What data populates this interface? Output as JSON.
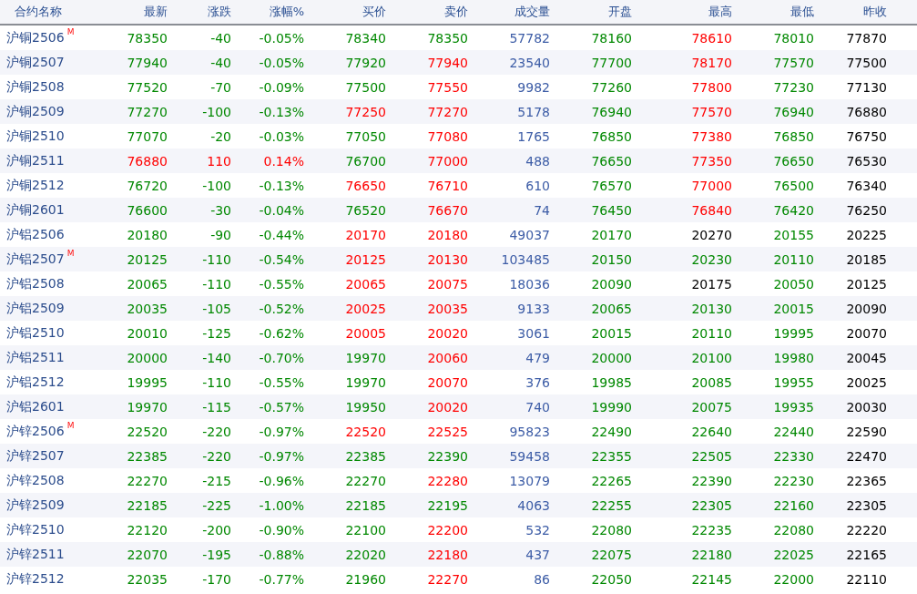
{
  "table": {
    "columns": [
      "合约名称",
      "最新",
      "涨跌",
      "涨幅%",
      "买价",
      "卖价",
      "成交量",
      "开盘",
      "最高",
      "最低",
      "昨收"
    ],
    "rows": [
      {
        "cells": [
          {
            "text": "沪铜2506",
            "badge": "M"
          },
          {
            "text": "78350",
            "color": "#008800"
          },
          {
            "text": "-40",
            "color": "#008800"
          },
          {
            "text": "-0.05%",
            "color": "#008800"
          },
          {
            "text": "78340",
            "color": "#008800"
          },
          {
            "text": "78350",
            "color": "#008800"
          },
          {
            "text": "57782",
            "color": "#3c5ca6"
          },
          {
            "text": "78160",
            "color": "#008800"
          },
          {
            "text": "78610",
            "color": "#ff0000"
          },
          {
            "text": "78010",
            "color": "#008800"
          },
          {
            "text": "77870",
            "color": "#000000"
          }
        ]
      },
      {
        "cells": [
          {
            "text": "沪铜2507"
          },
          {
            "text": "77940",
            "color": "#008800"
          },
          {
            "text": "-40",
            "color": "#008800"
          },
          {
            "text": "-0.05%",
            "color": "#008800"
          },
          {
            "text": "77920",
            "color": "#008800"
          },
          {
            "text": "77940",
            "color": "#ff0000"
          },
          {
            "text": "23540",
            "color": "#3c5ca6"
          },
          {
            "text": "77700",
            "color": "#008800"
          },
          {
            "text": "78170",
            "color": "#ff0000"
          },
          {
            "text": "77570",
            "color": "#008800"
          },
          {
            "text": "77500",
            "color": "#000000"
          }
        ]
      },
      {
        "cells": [
          {
            "text": "沪铜2508"
          },
          {
            "text": "77520",
            "color": "#008800"
          },
          {
            "text": "-70",
            "color": "#008800"
          },
          {
            "text": "-0.09%",
            "color": "#008800"
          },
          {
            "text": "77500",
            "color": "#008800"
          },
          {
            "text": "77550",
            "color": "#ff0000"
          },
          {
            "text": "9982",
            "color": "#3c5ca6"
          },
          {
            "text": "77260",
            "color": "#008800"
          },
          {
            "text": "77800",
            "color": "#ff0000"
          },
          {
            "text": "77230",
            "color": "#008800"
          },
          {
            "text": "77130",
            "color": "#000000"
          }
        ]
      },
      {
        "cells": [
          {
            "text": "沪铜2509"
          },
          {
            "text": "77270",
            "color": "#008800"
          },
          {
            "text": "-100",
            "color": "#008800"
          },
          {
            "text": "-0.13%",
            "color": "#008800"
          },
          {
            "text": "77250",
            "color": "#ff0000"
          },
          {
            "text": "77270",
            "color": "#ff0000"
          },
          {
            "text": "5178",
            "color": "#3c5ca6"
          },
          {
            "text": "76940",
            "color": "#008800"
          },
          {
            "text": "77570",
            "color": "#ff0000"
          },
          {
            "text": "76940",
            "color": "#008800"
          },
          {
            "text": "76880",
            "color": "#000000"
          }
        ]
      },
      {
        "cells": [
          {
            "text": "沪铜2510"
          },
          {
            "text": "77070",
            "color": "#008800"
          },
          {
            "text": "-20",
            "color": "#008800"
          },
          {
            "text": "-0.03%",
            "color": "#008800"
          },
          {
            "text": "77050",
            "color": "#008800"
          },
          {
            "text": "77080",
            "color": "#ff0000"
          },
          {
            "text": "1765",
            "color": "#3c5ca6"
          },
          {
            "text": "76850",
            "color": "#008800"
          },
          {
            "text": "77380",
            "color": "#ff0000"
          },
          {
            "text": "76850",
            "color": "#008800"
          },
          {
            "text": "76750",
            "color": "#000000"
          }
        ]
      },
      {
        "cells": [
          {
            "text": "沪铜2511"
          },
          {
            "text": "76880",
            "color": "#ff0000"
          },
          {
            "text": "110",
            "color": "#ff0000"
          },
          {
            "text": "0.14%",
            "color": "#ff0000"
          },
          {
            "text": "76700",
            "color": "#008800"
          },
          {
            "text": "77000",
            "color": "#ff0000"
          },
          {
            "text": "488",
            "color": "#3c5ca6"
          },
          {
            "text": "76650",
            "color": "#008800"
          },
          {
            "text": "77350",
            "color": "#ff0000"
          },
          {
            "text": "76650",
            "color": "#008800"
          },
          {
            "text": "76530",
            "color": "#000000"
          }
        ]
      },
      {
        "cells": [
          {
            "text": "沪铜2512"
          },
          {
            "text": "76720",
            "color": "#008800"
          },
          {
            "text": "-100",
            "color": "#008800"
          },
          {
            "text": "-0.13%",
            "color": "#008800"
          },
          {
            "text": "76650",
            "color": "#ff0000"
          },
          {
            "text": "76710",
            "color": "#ff0000"
          },
          {
            "text": "610",
            "color": "#3c5ca6"
          },
          {
            "text": "76570",
            "color": "#008800"
          },
          {
            "text": "77000",
            "color": "#ff0000"
          },
          {
            "text": "76500",
            "color": "#008800"
          },
          {
            "text": "76340",
            "color": "#000000"
          }
        ]
      },
      {
        "cells": [
          {
            "text": "沪铜2601"
          },
          {
            "text": "76600",
            "color": "#008800"
          },
          {
            "text": "-30",
            "color": "#008800"
          },
          {
            "text": "-0.04%",
            "color": "#008800"
          },
          {
            "text": "76520",
            "color": "#008800"
          },
          {
            "text": "76670",
            "color": "#ff0000"
          },
          {
            "text": "74",
            "color": "#3c5ca6"
          },
          {
            "text": "76450",
            "color": "#008800"
          },
          {
            "text": "76840",
            "color": "#ff0000"
          },
          {
            "text": "76420",
            "color": "#008800"
          },
          {
            "text": "76250",
            "color": "#000000"
          }
        ]
      },
      {
        "cells": [
          {
            "text": "沪铝2506"
          },
          {
            "text": "20180",
            "color": "#008800"
          },
          {
            "text": "-90",
            "color": "#008800"
          },
          {
            "text": "-0.44%",
            "color": "#008800"
          },
          {
            "text": "20170",
            "color": "#ff0000"
          },
          {
            "text": "20180",
            "color": "#ff0000"
          },
          {
            "text": "49037",
            "color": "#3c5ca6"
          },
          {
            "text": "20170",
            "color": "#008800"
          },
          {
            "text": "20270",
            "color": "#000000"
          },
          {
            "text": "20155",
            "color": "#008800"
          },
          {
            "text": "20225",
            "color": "#000000"
          }
        ]
      },
      {
        "cells": [
          {
            "text": "沪铝2507",
            "badge": "M"
          },
          {
            "text": "20125",
            "color": "#008800"
          },
          {
            "text": "-110",
            "color": "#008800"
          },
          {
            "text": "-0.54%",
            "color": "#008800"
          },
          {
            "text": "20125",
            "color": "#ff0000"
          },
          {
            "text": "20130",
            "color": "#ff0000"
          },
          {
            "text": "103485",
            "color": "#3c5ca6"
          },
          {
            "text": "20150",
            "color": "#008800"
          },
          {
            "text": "20230",
            "color": "#008800"
          },
          {
            "text": "20110",
            "color": "#008800"
          },
          {
            "text": "20185",
            "color": "#000000"
          }
        ]
      },
      {
        "cells": [
          {
            "text": "沪铝2508"
          },
          {
            "text": "20065",
            "color": "#008800"
          },
          {
            "text": "-110",
            "color": "#008800"
          },
          {
            "text": "-0.55%",
            "color": "#008800"
          },
          {
            "text": "20065",
            "color": "#ff0000"
          },
          {
            "text": "20075",
            "color": "#ff0000"
          },
          {
            "text": "18036",
            "color": "#3c5ca6"
          },
          {
            "text": "20090",
            "color": "#008800"
          },
          {
            "text": "20175",
            "color": "#000000"
          },
          {
            "text": "20050",
            "color": "#008800"
          },
          {
            "text": "20125",
            "color": "#000000"
          }
        ]
      },
      {
        "cells": [
          {
            "text": "沪铝2509"
          },
          {
            "text": "20035",
            "color": "#008800"
          },
          {
            "text": "-105",
            "color": "#008800"
          },
          {
            "text": "-0.52%",
            "color": "#008800"
          },
          {
            "text": "20025",
            "color": "#ff0000"
          },
          {
            "text": "20035",
            "color": "#ff0000"
          },
          {
            "text": "9133",
            "color": "#3c5ca6"
          },
          {
            "text": "20065",
            "color": "#008800"
          },
          {
            "text": "20130",
            "color": "#008800"
          },
          {
            "text": "20015",
            "color": "#008800"
          },
          {
            "text": "20090",
            "color": "#000000"
          }
        ]
      },
      {
        "cells": [
          {
            "text": "沪铝2510"
          },
          {
            "text": "20010",
            "color": "#008800"
          },
          {
            "text": "-125",
            "color": "#008800"
          },
          {
            "text": "-0.62%",
            "color": "#008800"
          },
          {
            "text": "20005",
            "color": "#ff0000"
          },
          {
            "text": "20020",
            "color": "#ff0000"
          },
          {
            "text": "3061",
            "color": "#3c5ca6"
          },
          {
            "text": "20015",
            "color": "#008800"
          },
          {
            "text": "20110",
            "color": "#008800"
          },
          {
            "text": "19995",
            "color": "#008800"
          },
          {
            "text": "20070",
            "color": "#000000"
          }
        ]
      },
      {
        "cells": [
          {
            "text": "沪铝2511"
          },
          {
            "text": "20000",
            "color": "#008800"
          },
          {
            "text": "-140",
            "color": "#008800"
          },
          {
            "text": "-0.70%",
            "color": "#008800"
          },
          {
            "text": "19970",
            "color": "#008800"
          },
          {
            "text": "20060",
            "color": "#ff0000"
          },
          {
            "text": "479",
            "color": "#3c5ca6"
          },
          {
            "text": "20000",
            "color": "#008800"
          },
          {
            "text": "20100",
            "color": "#008800"
          },
          {
            "text": "19980",
            "color": "#008800"
          },
          {
            "text": "20045",
            "color": "#000000"
          }
        ]
      },
      {
        "cells": [
          {
            "text": "沪铝2512"
          },
          {
            "text": "19995",
            "color": "#008800"
          },
          {
            "text": "-110",
            "color": "#008800"
          },
          {
            "text": "-0.55%",
            "color": "#008800"
          },
          {
            "text": "19970",
            "color": "#008800"
          },
          {
            "text": "20070",
            "color": "#ff0000"
          },
          {
            "text": "376",
            "color": "#3c5ca6"
          },
          {
            "text": "19985",
            "color": "#008800"
          },
          {
            "text": "20085",
            "color": "#008800"
          },
          {
            "text": "19955",
            "color": "#008800"
          },
          {
            "text": "20025",
            "color": "#000000"
          }
        ]
      },
      {
        "cells": [
          {
            "text": "沪铝2601"
          },
          {
            "text": "19970",
            "color": "#008800"
          },
          {
            "text": "-115",
            "color": "#008800"
          },
          {
            "text": "-0.57%",
            "color": "#008800"
          },
          {
            "text": "19950",
            "color": "#008800"
          },
          {
            "text": "20020",
            "color": "#ff0000"
          },
          {
            "text": "740",
            "color": "#3c5ca6"
          },
          {
            "text": "19990",
            "color": "#008800"
          },
          {
            "text": "20075",
            "color": "#008800"
          },
          {
            "text": "19935",
            "color": "#008800"
          },
          {
            "text": "20030",
            "color": "#000000"
          }
        ]
      },
      {
        "cells": [
          {
            "text": "沪锌2506",
            "badge": "M"
          },
          {
            "text": "22520",
            "color": "#008800"
          },
          {
            "text": "-220",
            "color": "#008800"
          },
          {
            "text": "-0.97%",
            "color": "#008800"
          },
          {
            "text": "22520",
            "color": "#ff0000"
          },
          {
            "text": "22525",
            "color": "#ff0000"
          },
          {
            "text": "95823",
            "color": "#3c5ca6"
          },
          {
            "text": "22490",
            "color": "#008800"
          },
          {
            "text": "22640",
            "color": "#008800"
          },
          {
            "text": "22440",
            "color": "#008800"
          },
          {
            "text": "22590",
            "color": "#000000"
          }
        ]
      },
      {
        "cells": [
          {
            "text": "沪锌2507"
          },
          {
            "text": "22385",
            "color": "#008800"
          },
          {
            "text": "-220",
            "color": "#008800"
          },
          {
            "text": "-0.97%",
            "color": "#008800"
          },
          {
            "text": "22385",
            "color": "#008800"
          },
          {
            "text": "22390",
            "color": "#008800"
          },
          {
            "text": "59458",
            "color": "#3c5ca6"
          },
          {
            "text": "22355",
            "color": "#008800"
          },
          {
            "text": "22505",
            "color": "#008800"
          },
          {
            "text": "22330",
            "color": "#008800"
          },
          {
            "text": "22470",
            "color": "#000000"
          }
        ]
      },
      {
        "cells": [
          {
            "text": "沪锌2508"
          },
          {
            "text": "22270",
            "color": "#008800"
          },
          {
            "text": "-215",
            "color": "#008800"
          },
          {
            "text": "-0.96%",
            "color": "#008800"
          },
          {
            "text": "22270",
            "color": "#008800"
          },
          {
            "text": "22280",
            "color": "#ff0000"
          },
          {
            "text": "13079",
            "color": "#3c5ca6"
          },
          {
            "text": "22265",
            "color": "#008800"
          },
          {
            "text": "22390",
            "color": "#008800"
          },
          {
            "text": "22230",
            "color": "#008800"
          },
          {
            "text": "22365",
            "color": "#000000"
          }
        ]
      },
      {
        "cells": [
          {
            "text": "沪锌2509"
          },
          {
            "text": "22185",
            "color": "#008800"
          },
          {
            "text": "-225",
            "color": "#008800"
          },
          {
            "text": "-1.00%",
            "color": "#008800"
          },
          {
            "text": "22185",
            "color": "#008800"
          },
          {
            "text": "22195",
            "color": "#008800"
          },
          {
            "text": "4063",
            "color": "#3c5ca6"
          },
          {
            "text": "22255",
            "color": "#008800"
          },
          {
            "text": "22305",
            "color": "#008800"
          },
          {
            "text": "22160",
            "color": "#008800"
          },
          {
            "text": "22305",
            "color": "#000000"
          }
        ]
      },
      {
        "cells": [
          {
            "text": "沪锌2510"
          },
          {
            "text": "22120",
            "color": "#008800"
          },
          {
            "text": "-200",
            "color": "#008800"
          },
          {
            "text": "-0.90%",
            "color": "#008800"
          },
          {
            "text": "22100",
            "color": "#008800"
          },
          {
            "text": "22200",
            "color": "#ff0000"
          },
          {
            "text": "532",
            "color": "#3c5ca6"
          },
          {
            "text": "22080",
            "color": "#008800"
          },
          {
            "text": "22235",
            "color": "#008800"
          },
          {
            "text": "22080",
            "color": "#008800"
          },
          {
            "text": "22220",
            "color": "#000000"
          }
        ]
      },
      {
        "cells": [
          {
            "text": "沪锌2511"
          },
          {
            "text": "22070",
            "color": "#008800"
          },
          {
            "text": "-195",
            "color": "#008800"
          },
          {
            "text": "-0.88%",
            "color": "#008800"
          },
          {
            "text": "22020",
            "color": "#008800"
          },
          {
            "text": "22180",
            "color": "#ff0000"
          },
          {
            "text": "437",
            "color": "#3c5ca6"
          },
          {
            "text": "22075",
            "color": "#008800"
          },
          {
            "text": "22180",
            "color": "#008800"
          },
          {
            "text": "22025",
            "color": "#008800"
          },
          {
            "text": "22165",
            "color": "#000000"
          }
        ]
      },
      {
        "cells": [
          {
            "text": "沪锌2512"
          },
          {
            "text": "22035",
            "color": "#008800"
          },
          {
            "text": "-170",
            "color": "#008800"
          },
          {
            "text": "-0.77%",
            "color": "#008800"
          },
          {
            "text": "21960",
            "color": "#008800"
          },
          {
            "text": "22270",
            "color": "#ff0000"
          },
          {
            "text": "86",
            "color": "#3c5ca6"
          },
          {
            "text": "22050",
            "color": "#008800"
          },
          {
            "text": "22145",
            "color": "#008800"
          },
          {
            "text": "22000",
            "color": "#008800"
          },
          {
            "text": "22110",
            "color": "#000000"
          }
        ]
      }
    ]
  }
}
